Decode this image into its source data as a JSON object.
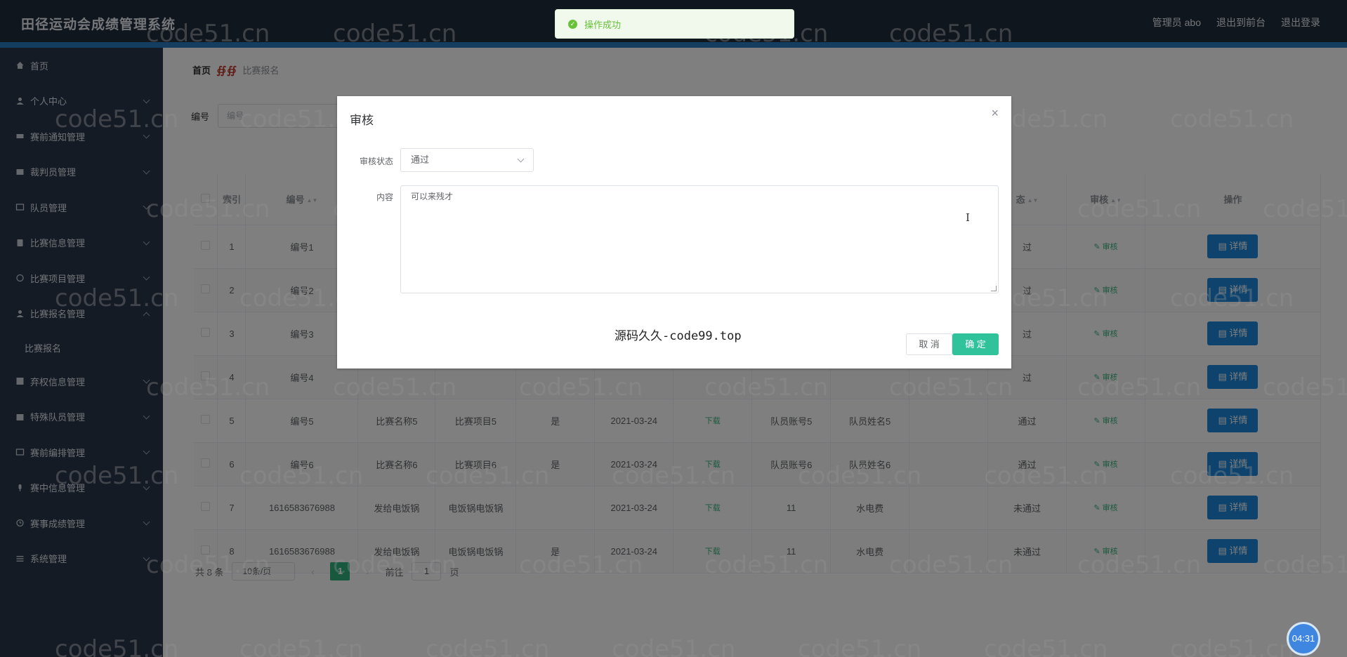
{
  "app": {
    "title": "田径运动会成绩管理系统"
  },
  "header": {
    "links": [
      "管理员 abo",
      "退出到前台",
      "退出登录"
    ]
  },
  "sidebar": {
    "items": [
      {
        "label": "首页",
        "icon": "home-icon",
        "chevron": false
      },
      {
        "label": "个人中心",
        "icon": "user-icon",
        "chevron": true
      },
      {
        "label": "赛前通知管理",
        "icon": "notice-icon",
        "chevron": true
      },
      {
        "label": "裁判员管理",
        "icon": "judge-icon",
        "chevron": true
      },
      {
        "label": "队员管理",
        "icon": "team-icon",
        "chevron": true
      },
      {
        "label": "比赛信息管理",
        "icon": "info-icon",
        "chevron": true
      },
      {
        "label": "比赛项目管理",
        "icon": "event-icon",
        "chevron": true
      },
      {
        "label": "比赛报名管理",
        "icon": "user-icon",
        "chevron": true,
        "expanded": true
      }
    ],
    "sub_item": "比赛报名",
    "items_after": [
      {
        "label": "弃权信息管理",
        "icon": "forfeit-icon",
        "chevron": true
      },
      {
        "label": "特殊队员管理",
        "icon": "special-icon",
        "chevron": true
      },
      {
        "label": "赛前编排管理",
        "icon": "schedule-icon",
        "chevron": true
      },
      {
        "label": "赛中信息管理",
        "icon": "mic-icon",
        "chevron": true
      },
      {
        "label": "赛事成绩管理",
        "icon": "clock-icon",
        "chevron": true
      },
      {
        "label": "系统管理",
        "icon": "menu-icon",
        "chevron": true
      }
    ]
  },
  "breadcrumb": {
    "home": "首页",
    "separator": "∯∯",
    "current": "比赛报名"
  },
  "search": {
    "label": "编号",
    "placeholder": "编号"
  },
  "table": {
    "headers": [
      "索引",
      "编号",
      "态",
      "审核",
      "操作"
    ],
    "rows": [
      {
        "idx": "1",
        "code": "编号1",
        "name": "",
        "project": "",
        "yes": "",
        "date": "",
        "dl": "",
        "acct": "",
        "pname": "",
        "status": "过",
        "audit": "审核",
        "detail": "详情"
      },
      {
        "idx": "2",
        "code": "编号2",
        "name": "",
        "project": "",
        "yes": "",
        "date": "",
        "dl": "",
        "acct": "",
        "pname": "",
        "status": "过",
        "audit": "审核",
        "detail": "详情"
      },
      {
        "idx": "3",
        "code": "编号3",
        "name": "",
        "project": "",
        "yes": "",
        "date": "",
        "dl": "",
        "acct": "",
        "pname": "",
        "status": "过",
        "audit": "审核",
        "detail": "详情"
      },
      {
        "idx": "4",
        "code": "编号4",
        "name": "",
        "project": "",
        "yes": "",
        "date": "",
        "dl": "",
        "acct": "",
        "pname": "",
        "status": "过",
        "audit": "审核",
        "detail": "详情"
      },
      {
        "idx": "5",
        "code": "编号5",
        "name": "比赛名称5",
        "project": "比赛项目5",
        "yes": "是",
        "date": "2021-03-24",
        "dl": "下载",
        "acct": "队员账号5",
        "pname": "队员姓名5",
        "status": "通过",
        "audit": "审核",
        "detail": "详情"
      },
      {
        "idx": "6",
        "code": "编号6",
        "name": "比赛名称6",
        "project": "比赛项目6",
        "yes": "是",
        "date": "2021-03-24",
        "dl": "下载",
        "acct": "队员账号6",
        "pname": "队员姓名6",
        "status": "通过",
        "audit": "审核",
        "detail": "详情"
      },
      {
        "idx": "7",
        "code": "1616583676988",
        "name": "发给电饭锅",
        "project": "电饭锅电饭锅",
        "yes": "",
        "date": "2021-03-24",
        "dl": "下载",
        "acct": "11",
        "pname": "水电费",
        "status": "未通过",
        "audit": "审核",
        "detail": "详情"
      },
      {
        "idx": "8",
        "code": "1616583676988",
        "name": "发给电饭锅",
        "project": "电饭锅电饭锅",
        "yes": "是",
        "date": "2021-03-24",
        "dl": "下载",
        "acct": "11",
        "pname": "水电费",
        "status": "未通过",
        "audit": "审核",
        "detail": "详情"
      }
    ]
  },
  "pagination": {
    "total": "共 8 条",
    "page_size": "10条/页",
    "current": "1",
    "goto_label": "前往",
    "goto_value": "1",
    "page_suffix": "页"
  },
  "dialog": {
    "title": "审核",
    "status_label": "审核状态",
    "status_value": "通过",
    "content_label": "内容",
    "content_value": "可以来残才",
    "promo": "源码久久-code99.top",
    "cancel": "取 消",
    "confirm": "确 定"
  },
  "toast": {
    "message": "操作成功"
  },
  "watermark": "code51.cn",
  "timer": "04:31",
  "colors": {
    "topbar": "#202c3d",
    "sidebar": "#2b3648",
    "accent": "#2b7bc0",
    "detail_button": "#1a86d8",
    "confirm_button": "#2fc29b"
  }
}
